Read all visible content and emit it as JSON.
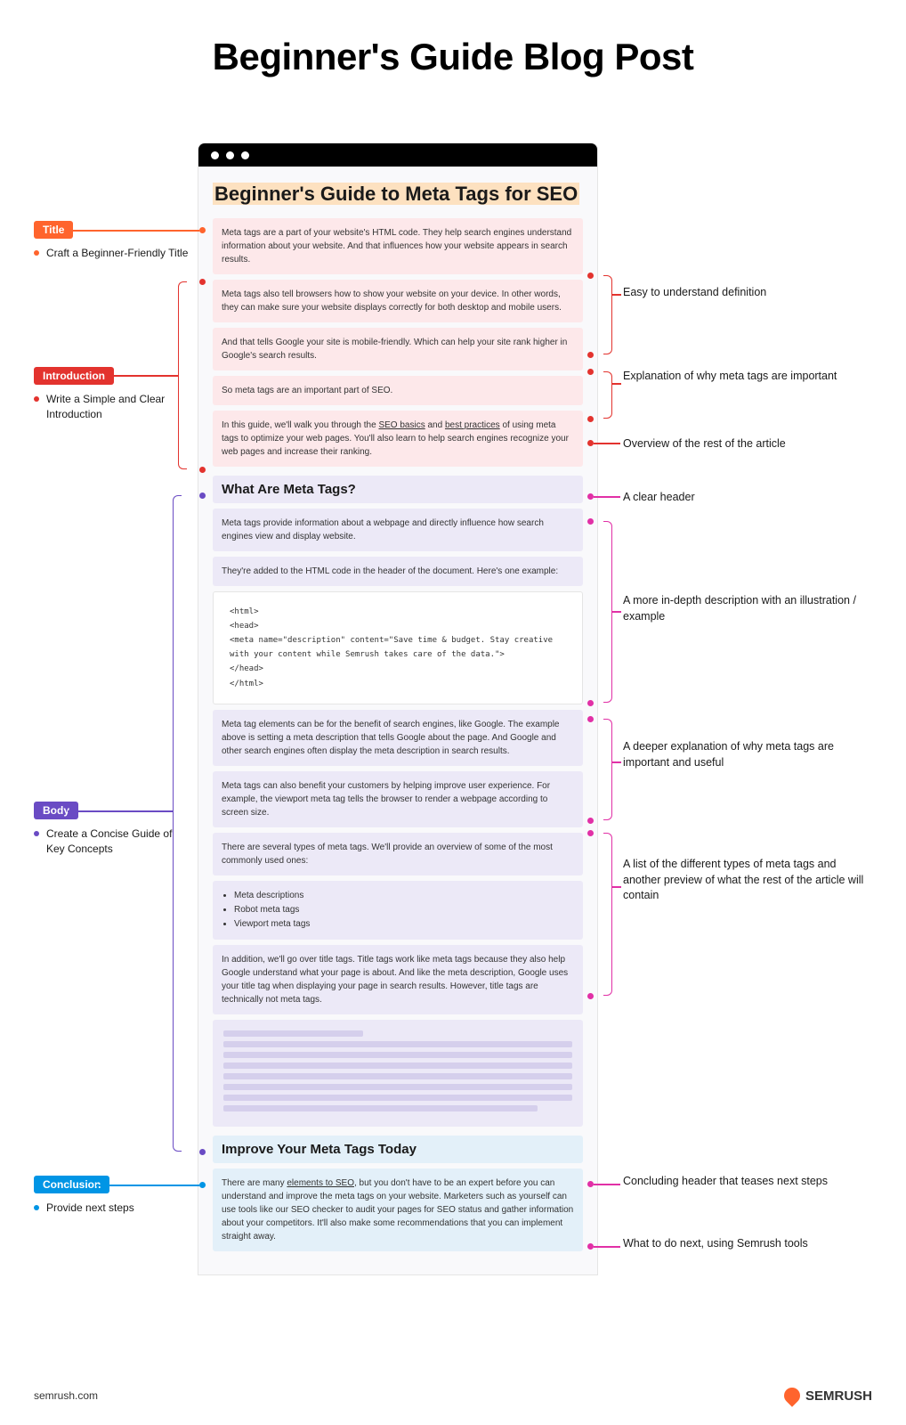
{
  "page_title": "Beginner's Guide Blog Post",
  "blog": {
    "title": "Beginner's Guide to Meta Tags for SEO",
    "intro": [
      "Meta tags are a part of your website's HTML code. They help search engines understand information about your website. And that influences how your website appears in search results.",
      "Meta tags also tell browsers how to show your website on your device. In other words, they can make sure your website displays correctly for both desktop and mobile users.",
      "And that tells Google your site is mobile-friendly. Which can help your site rank higher in Google's search results.",
      "So meta tags are an important part of SEO.",
      "In this guide, we'll walk you through the SEO basics and best practices of using meta tags to optimize your web pages. You'll also learn to help search engines recognize your web pages and increase their ranking."
    ],
    "body_header": "What Are Meta Tags?",
    "body": [
      "Meta tags provide information about a webpage and directly influence how search engines view and display website.",
      "They're added to the HTML code in the header of the document. Here's one example:"
    ],
    "code": "<html>\n<head>\n<meta name=\"description\" content=\"Save time & budget. Stay creative\nwith your content while Semrush takes care of the data.\">\n</head>\n</html>",
    "body2": [
      "Meta tag elements can be for the benefit of search engines, like Google. The example above is setting a meta description that tells Google about the page. And Google and other search engines often display the meta description in search results.",
      "Meta tags can also benefit your customers by helping improve user experience. For example, the viewport meta tag tells the browser to render a webpage according to screen size.",
      "There are several types of meta tags. We'll provide an overview of some of the most commonly used ones:"
    ],
    "list": [
      "Meta descriptions",
      "Robot meta tags",
      "Viewport meta tags"
    ],
    "body3": "In addition, we'll go over title tags. Title tags work like meta tags because they also help Google understand what your page is about. And like the meta description, Google uses your title tag when displaying your page in search results. However, title tags are technically not meta tags.",
    "conclusion_header": "Improve Your Meta Tags Today",
    "conclusion": "There are many elements to SEO, but you don't have to be an expert before you can understand and improve the meta tags on your website. Marketers such as yourself can use tools like our SEO checker to audit your pages for SEO status and gather information about your competitors. It'll also make some recommendations that you can implement straight away."
  },
  "left": {
    "title_tag": "Title",
    "title_text": "Craft a Beginner-Friendly Title",
    "intro_tag": "Introduction",
    "intro_text": "Write a Simple and Clear Introduction",
    "body_tag": "Body",
    "body_text": "Create a Concise Guide of Key Concepts",
    "conc_tag": "Conclusion",
    "conc_text": "Provide next steps"
  },
  "right": {
    "r1": "Easy to understand definition",
    "r2": "Explanation of why meta tags are important",
    "r3": "Overview of the rest of the article",
    "r4": "A clear header",
    "r5": "A more in-depth description with an illustration / example",
    "r6": "A deeper explanation of why meta tags are important and useful",
    "r7": "A list of the different types of meta tags and another preview of what the rest of the article will contain",
    "r8": "Concluding header that teases next steps",
    "r9": "What to do next, using Semrush tools"
  },
  "footer": {
    "url": "semrush.com",
    "brand": "SEMRUSH"
  }
}
